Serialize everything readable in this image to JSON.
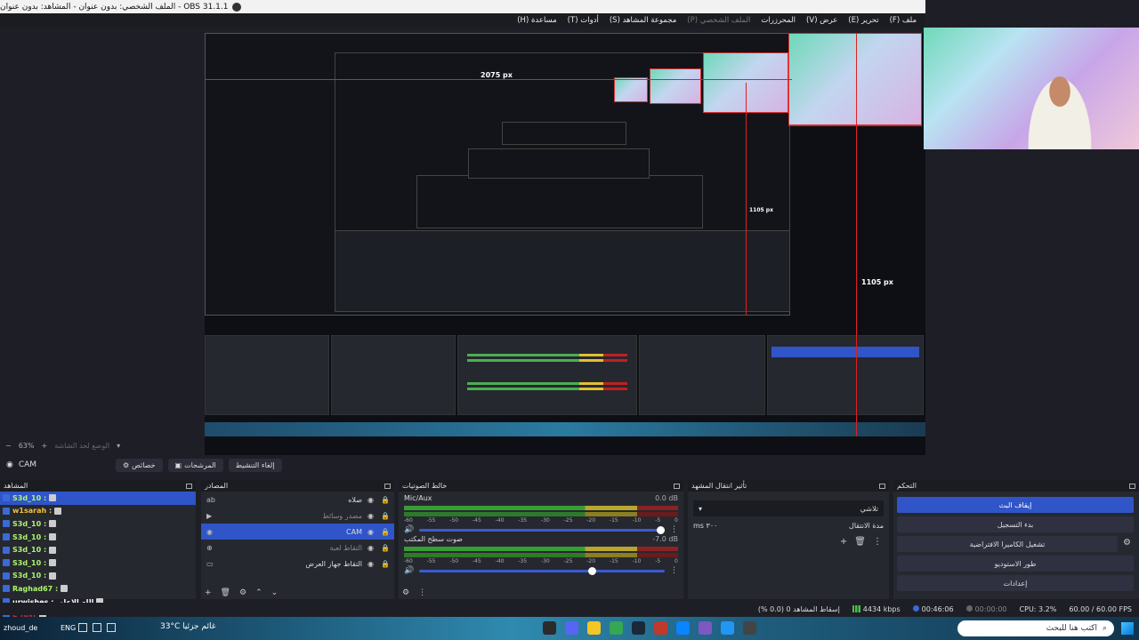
{
  "window": {
    "title": "OBS 31.1.1 - الملف الشخصي: بدون عنوان - المشاهد: بدون عنوان"
  },
  "menu": [
    {
      "label": "ملف (F)",
      "dim": false
    },
    {
      "label": "تحرير (E)",
      "dim": false
    },
    {
      "label": "عرض (V)",
      "dim": false
    },
    {
      "label": "المحرزرات",
      "dim": false
    },
    {
      "label": "الملف الشخصي (P)",
      "dim": true
    },
    {
      "label": "مجموعة المشاهد (S)",
      "dim": false
    },
    {
      "label": "أدوات (T)",
      "dim": false
    },
    {
      "label": "مساعدة (H)",
      "dim": false
    }
  ],
  "preview": {
    "labels": [
      "2075 px",
      "1105 px",
      "1105 px"
    ],
    "zoom": "63%",
    "fixed_scene_label": "الوضع لحد الشاشة"
  },
  "toolbar": {
    "source_name": "CAM",
    "properties": "خصائص",
    "filters": "المرشحات",
    "deactivate": "إلغاء التنشيط"
  },
  "scenes": {
    "title": "المشاهد",
    "items": [
      {
        "label": "S3d_10 :",
        "style": "chat-a",
        "selected": true
      },
      {
        "label": "w1sarah :",
        "style": "chat-b",
        "selected": false
      },
      {
        "label": "S3d_10 :",
        "style": "chat-a",
        "selected": false
      },
      {
        "label": "S3d_10 :",
        "style": "chat-a",
        "selected": false
      },
      {
        "label": "S3d_10 :",
        "style": "chat-a",
        "selected": false
      },
      {
        "label": "S3d_10 :",
        "style": "chat-a",
        "selected": false
      },
      {
        "label": "S3d_10 :",
        "style": "chat-a",
        "selected": false
      },
      {
        "label": "Raghad67 :",
        "style": "chat-a",
        "selected": false
      },
      {
        "label": "urwishes : الله الاعلى",
        "style": "chat-c",
        "selected": false
      },
      {
        "label": "L'Yavr",
        "style": "chat-d",
        "selected": false
      }
    ],
    "footer_user": "zhoud_de"
  },
  "sources": {
    "title": "المصادر",
    "items": [
      {
        "label": "صلاه",
        "glyph": "ab",
        "selected": false,
        "dim": false
      },
      {
        "label": "مصدر وسائط",
        "glyph": "▶",
        "selected": false,
        "dim": true
      },
      {
        "label": "CAM",
        "glyph": "◉",
        "selected": true,
        "dim": false
      },
      {
        "label": "التقاط لعبة",
        "glyph": "⊕",
        "selected": false,
        "dim": true
      },
      {
        "label": "التقاط جهاز العرض",
        "glyph": "▭",
        "selected": false,
        "dim": false
      }
    ]
  },
  "mixer": {
    "title": "خالط الصوتيات",
    "scale": [
      "-60",
      "-55",
      "-50",
      "-45",
      "-40",
      "-35",
      "-30",
      "-25",
      "-20",
      "-15",
      "-10",
      "-5",
      "0"
    ],
    "channels": [
      {
        "name": "Mic/Aux",
        "db": "0.0 dB",
        "level": 0.66,
        "volume": 1.0
      },
      {
        "name": "صوت سطح المكتب",
        "db": "-7.0 dB",
        "level": 0.84,
        "volume": 0.72
      }
    ]
  },
  "transitions": {
    "title": "تأثير انتقال المشهد",
    "selected": "تلاشي",
    "duration_label": "مدة الانتقال",
    "duration_value": "٣٠٠ ms"
  },
  "controls": {
    "title": "التحكم",
    "stop_stream": "إيقاف البث",
    "start_record": "بدء التسجيل",
    "virtual_cam": "تشغيل الكاميرا الافتراضية",
    "studio_mode": "طور الاستوديو",
    "settings": "إعدادات"
  },
  "status": {
    "dropped": "إسقاط المشاهد 0 (0.0 %)",
    "bitrate": "4434 kbps",
    "stream_time": "00:46:06",
    "record_time": "00:00:00",
    "cpu": "CPU: 3.2%",
    "fps": "60.00 / 60.00 FPS"
  },
  "taskbar": {
    "search_placeholder": "اكتب هنا للبحث",
    "weather": "33°C غائم جزئيا",
    "lang": "ENG"
  },
  "colors": {
    "accent": "#2f55c8",
    "chat_green": "#aef56d",
    "chat_gold": "#f0c040"
  }
}
